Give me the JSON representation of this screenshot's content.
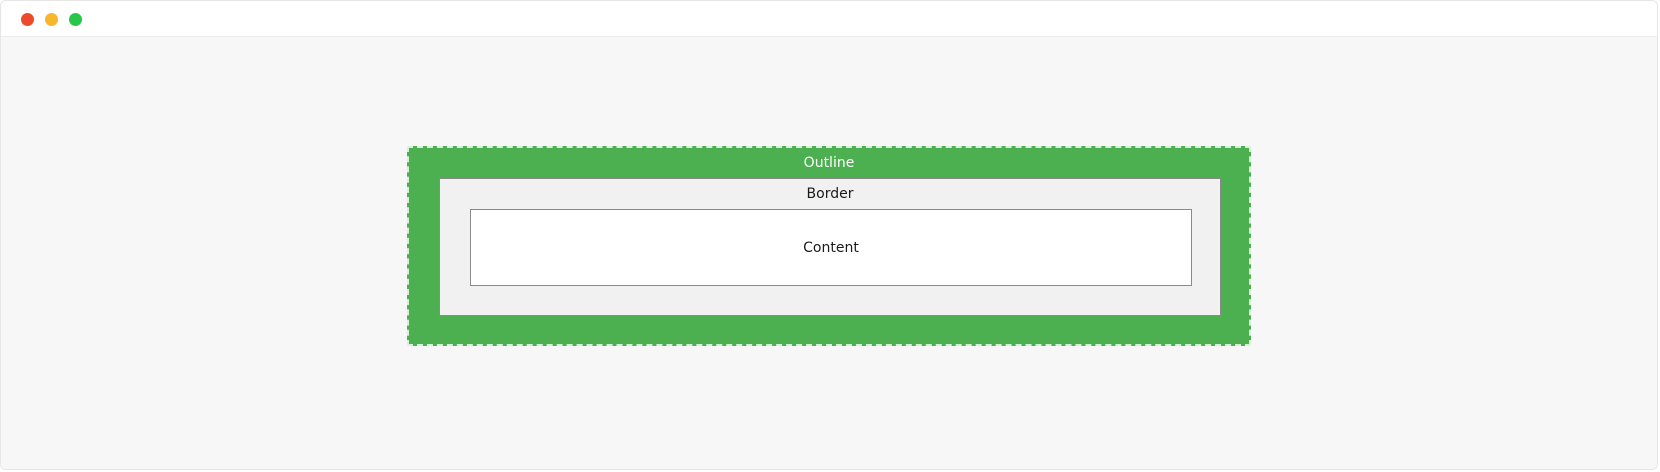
{
  "window": {
    "controls": [
      "close",
      "minimize",
      "maximize"
    ],
    "colors": {
      "close": "#ec4a2c",
      "minimize": "#f7b72d",
      "maximize": "#2ac64a"
    }
  },
  "diagram": {
    "outline": {
      "label": "Outline",
      "color": "#4caf50"
    },
    "border": {
      "label": "Border",
      "color": "#f1f1f1"
    },
    "content": {
      "label": "Content",
      "color": "#ffffff"
    }
  }
}
